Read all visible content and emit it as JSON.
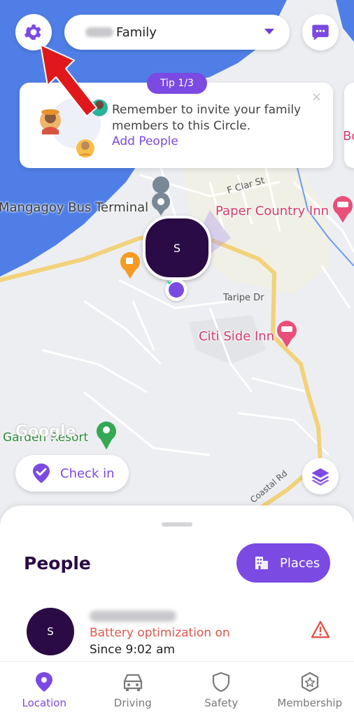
{
  "header": {
    "circle_name": "Family"
  },
  "tip": {
    "badge": "Tip 1/3",
    "message": "Remember to invite your family members to this Circle.",
    "link": "Add People",
    "close": "×",
    "next_card_peek": "Bo"
  },
  "map": {
    "labels": {
      "bus_terminal": "Mangagoy Bus Terminal",
      "paper_country_inn": "Paper Country Inn",
      "citi_side_inn": "Citi Side Inn",
      "garden_resort": "Garden Resort",
      "street_clar": "F Clar St",
      "street_taripe": "Taripe Dr",
      "street_coastal": "Coastal Rd",
      "google": "Google"
    },
    "marker_initial": "S"
  },
  "actions": {
    "check_in": "Check in"
  },
  "sheet": {
    "title": "People",
    "places_button": "Places",
    "person": {
      "initial": "S",
      "status": "Battery optimization on",
      "since": "Since 9:02 am"
    }
  },
  "nav": {
    "items": [
      {
        "label": "Location",
        "icon": "location-pin-icon",
        "active": true
      },
      {
        "label": "Driving",
        "icon": "car-icon",
        "active": false
      },
      {
        "label": "Safety",
        "icon": "shield-icon",
        "active": false
      },
      {
        "label": "Membership",
        "icon": "star-badge-icon",
        "active": false
      }
    ]
  },
  "colors": {
    "accent": "#7b4ae2",
    "dark_purple": "#2a0b45",
    "warning": "#e0574d",
    "water": "#4f7fe6",
    "road": "#f6d98a"
  }
}
